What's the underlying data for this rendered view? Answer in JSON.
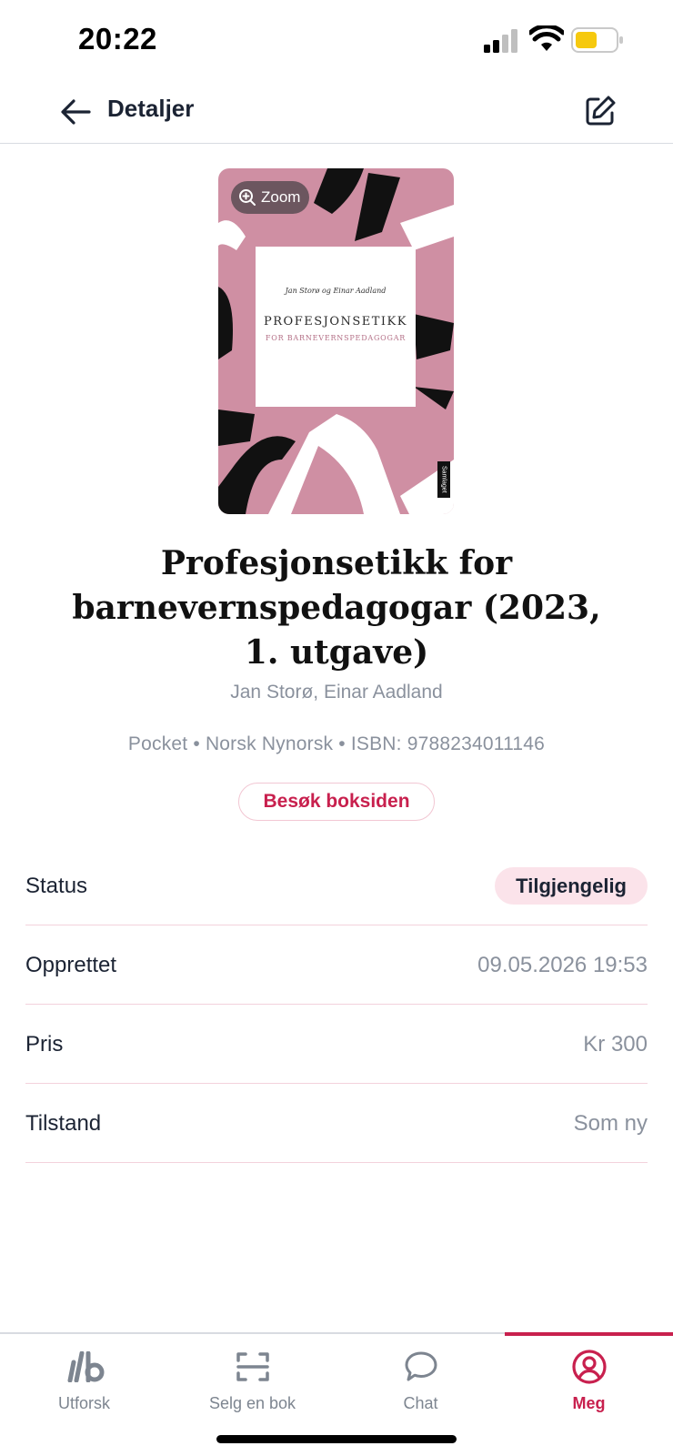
{
  "status_bar": {
    "time": "20:22"
  },
  "header": {
    "title": "Detaljer"
  },
  "cover": {
    "zoom_label": "Zoom",
    "authors": "Jan Storø og Einar Aadland",
    "title": "PROFESJONSETIKK",
    "subtitle": "FOR BARNEVERNSPEDAGOGAR",
    "publisher": "Samlaget"
  },
  "book": {
    "title": "Profesjonsetikk for barnevernspedagogar (2023, 1. utgave)",
    "authors": "Jan Storø, Einar Aadland",
    "meta": "Pocket • Norsk Nynorsk • ISBN: 9788234011146",
    "visit_button": "Besøk boksiden"
  },
  "details": {
    "status_label": "Status",
    "status_value": "Tilgjengelig",
    "created_label": "Opprettet",
    "created_value": "09.05.2026 19:53",
    "price_label": "Pris",
    "price_value": "Kr 300",
    "condition_label": "Tilstand",
    "condition_value": "Som ny"
  },
  "tabs": [
    {
      "label": "Utforsk",
      "icon": "lb-logo-icon"
    },
    {
      "label": "Selg en bok",
      "icon": "scan-icon"
    },
    {
      "label": "Chat",
      "icon": "chat-bubble-icon"
    },
    {
      "label": "Meg",
      "icon": "user-circle-icon",
      "active": true
    }
  ],
  "colors": {
    "accent": "#c8204e",
    "cover_pink": "#cf8fa3",
    "badge_bg": "#fbe3ea",
    "muted_text": "#8a919d"
  }
}
